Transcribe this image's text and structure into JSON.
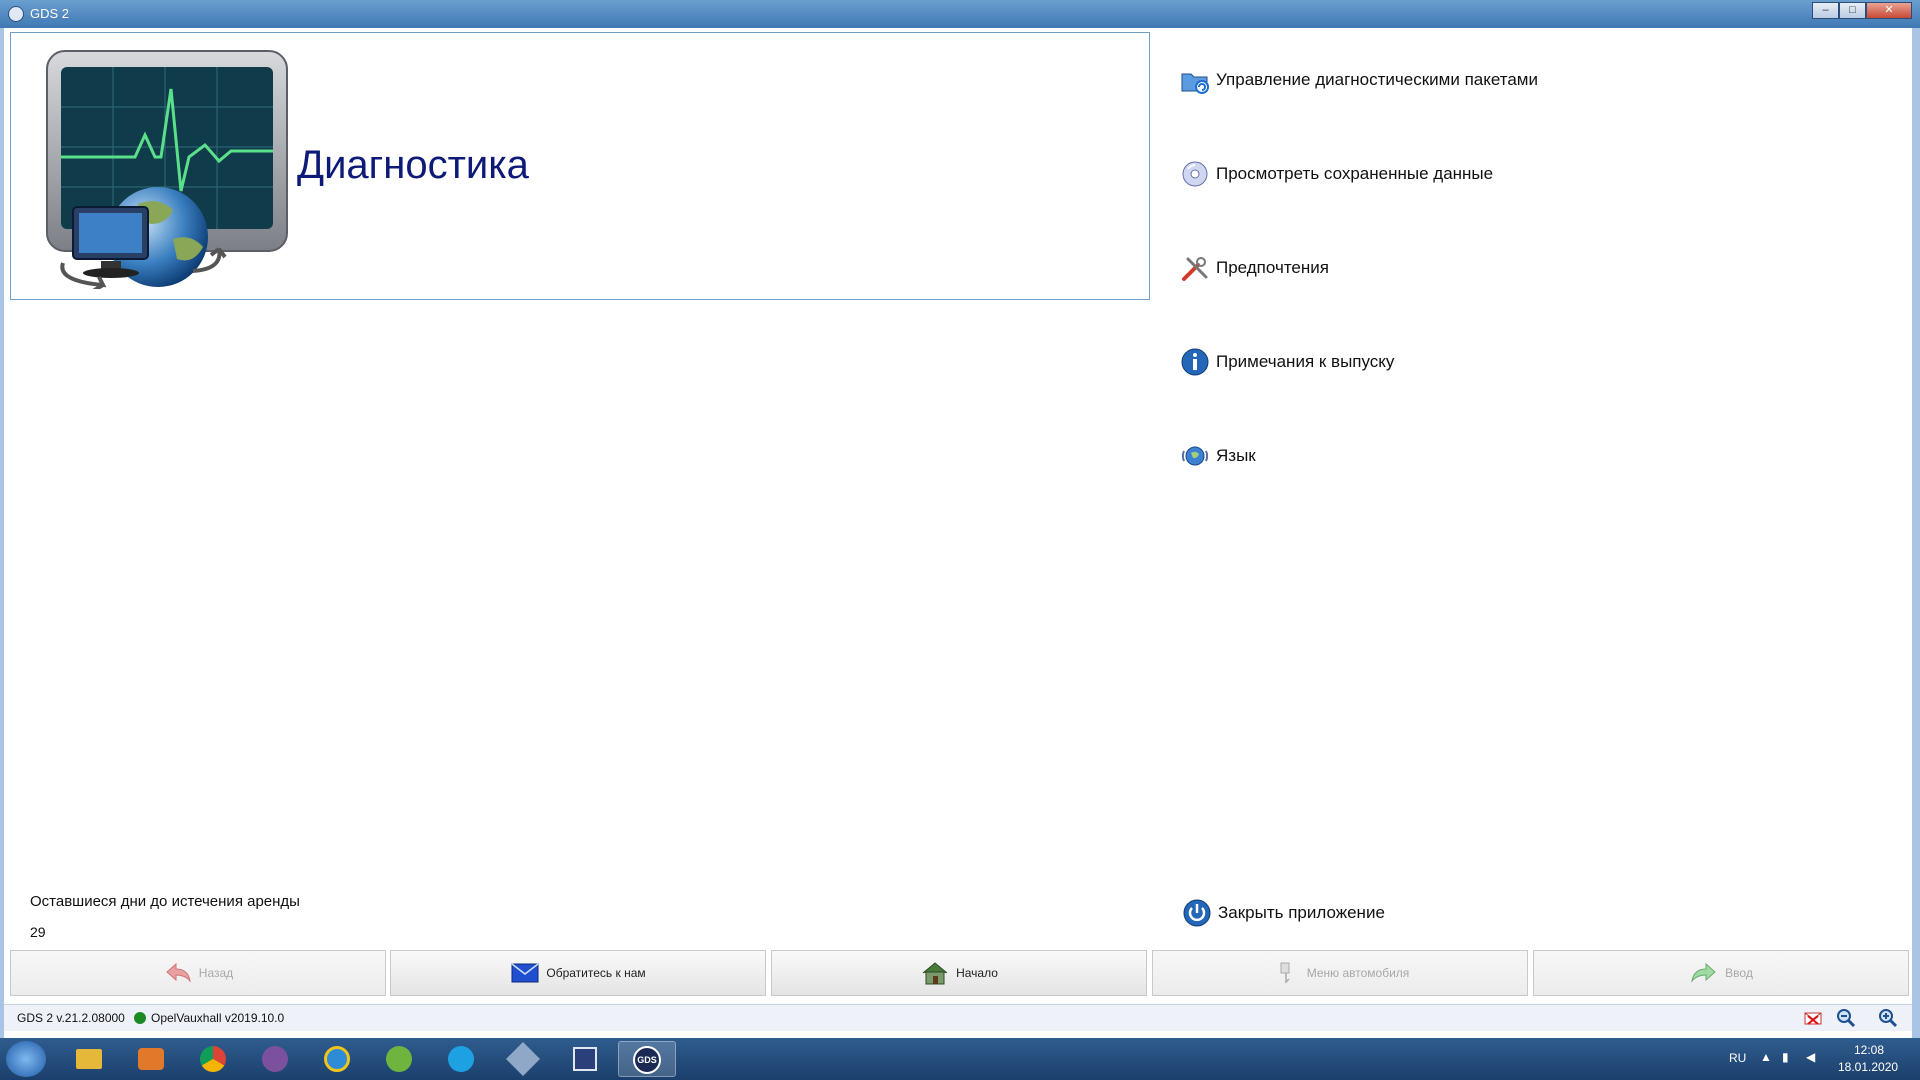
{
  "window": {
    "title": "GDS 2",
    "minimize": "–",
    "maximize": "□",
    "close": "✕"
  },
  "header": {
    "title": "Диагностика"
  },
  "menu": {
    "items": [
      {
        "label": "Управление диагностическими пакетами",
        "icon": "folder-refresh-icon"
      },
      {
        "label": "Просмотреть сохраненные данные",
        "icon": "disc-icon"
      },
      {
        "label": "Предпочтения",
        "icon": "tools-icon"
      },
      {
        "label": "Примечания к выпуску",
        "icon": "info-icon"
      },
      {
        "label": "Язык",
        "icon": "language-globe-icon"
      }
    ],
    "close_app": {
      "label": "Закрыть приложение",
      "icon": "power-icon"
    }
  },
  "lease": {
    "label": "Оставшиеся дни до истечения аренды",
    "days": "29"
  },
  "nav_buttons": [
    {
      "label": "Назад",
      "icon": "back-arrow-icon",
      "enabled": false
    },
    {
      "label": "Обратитесь к нам",
      "icon": "envelope-icon",
      "enabled": true
    },
    {
      "label": "Начало",
      "icon": "home-icon",
      "enabled": true
    },
    {
      "label": "Меню автомобиля",
      "icon": "car-menu-icon",
      "enabled": false
    },
    {
      "label": "Ввод",
      "icon": "enter-arrow-icon",
      "enabled": false
    }
  ],
  "status": {
    "version": "GDS 2 v.21.2.08000",
    "database": "OpelVauxhall v2019.10.0",
    "database_status_color": "#1c8a24"
  },
  "taskbar": {
    "language": "RU",
    "time": "12:08",
    "date": "18.01.2020",
    "active_app_label": "GDS"
  }
}
